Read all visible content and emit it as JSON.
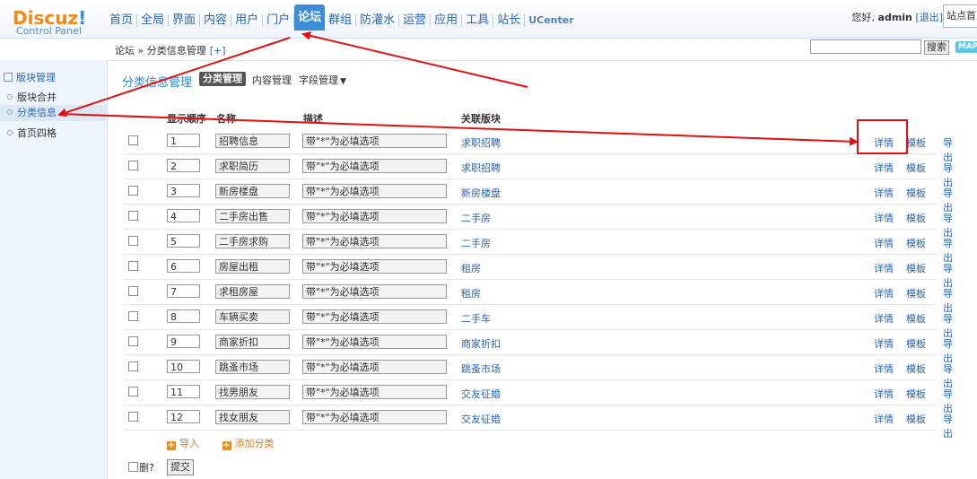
{
  "header": {
    "logo_brand": "Discuz",
    "logo_excl": "!",
    "logo_sub": "Control Panel",
    "nav": [
      "首页",
      "全局",
      "界面",
      "内容",
      "用户",
      "门户",
      "论坛",
      "群组",
      "防灌水",
      "运营",
      "应用",
      "工具",
      "站长",
      "UCenter"
    ],
    "active_nav": "论坛",
    "greeting": "您好, ",
    "username": "admin",
    "logout": "[退出]",
    "site_home": "站点首页"
  },
  "breadcrumb": {
    "text": "论坛 » 分类信息管理",
    "add": "[+]"
  },
  "search": {
    "button": "搜索",
    "map": "MAP"
  },
  "sidebar": {
    "section": "版块管理",
    "items": [
      "版块合并",
      "分类信息",
      "首页四格"
    ],
    "active": "分类信息"
  },
  "main": {
    "title": "分类信息管理",
    "tabs": {
      "category": "分类管理",
      "content": "内容管理",
      "fields": "字段管理",
      "fields_caret": "▼"
    },
    "columns": {
      "order": "显示顺序",
      "name": "名称",
      "desc": "描述",
      "forum": "关联版块"
    },
    "actions": {
      "detail": "详情",
      "template": "模板",
      "export": "导出"
    },
    "rows": [
      {
        "order": "1",
        "name": "招聘信息",
        "desc": "带\"*\"为必填选项",
        "forum": "求职招聘"
      },
      {
        "order": "2",
        "name": "求职简历",
        "desc": "带\"*\"为必填选项",
        "forum": "求职招聘"
      },
      {
        "order": "3",
        "name": "新房楼盘",
        "desc": "带\"*\"为必填选项",
        "forum": "新房楼盘"
      },
      {
        "order": "4",
        "name": "二手房出售",
        "desc": "带\"*\"为必填选项",
        "forum": "二手房"
      },
      {
        "order": "5",
        "name": "二手房求购",
        "desc": "带\"*\"为必填选项",
        "forum": "二手房"
      },
      {
        "order": "6",
        "name": "房屋出租",
        "desc": "带\"*\"为必填选项",
        "forum": "租房"
      },
      {
        "order": "7",
        "name": "求租房屋",
        "desc": "带\"*\"为必填选项",
        "forum": "租房"
      },
      {
        "order": "8",
        "name": "车辆买卖",
        "desc": "带\"*\"为必填选项",
        "forum": "二手车"
      },
      {
        "order": "9",
        "name": "商家折扣",
        "desc": "带\"*\"为必填选项",
        "forum": "商家折扣"
      },
      {
        "order": "10",
        "name": "跳蚤市场",
        "desc": "带\"*\"为必填选项",
        "forum": "跳蚤市场"
      },
      {
        "order": "11",
        "name": "找男朋友",
        "desc": "带\"*\"为必填选项",
        "forum": "交友征婚"
      },
      {
        "order": "12",
        "name": "找女朋友",
        "desc": "带\"*\"为必填选项",
        "forum": "交友征婚"
      }
    ],
    "import": "导入",
    "add_category": "添加分类",
    "delete_label": "删?",
    "submit": "提交"
  },
  "colors": {
    "accent": "#3a8dd6",
    "link": "#2b65b7",
    "logo_orange": "#f08c16",
    "annotation_red": "#e01010"
  }
}
